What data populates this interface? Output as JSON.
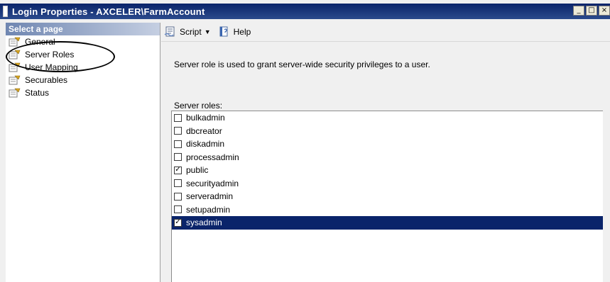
{
  "window": {
    "title": "Login Properties - AXCELER\\FarmAccount",
    "caption_buttons": {
      "minimize": "_",
      "maximize": "□",
      "close": "×"
    }
  },
  "left_pane": {
    "header": "Select a page",
    "items": [
      {
        "label": "General",
        "icon": "page-wrench-icon"
      },
      {
        "label": "Server Roles",
        "icon": "page-wrench-icon",
        "circled": true
      },
      {
        "label": "User Mapping",
        "icon": "page-wrench-icon"
      },
      {
        "label": "Securables",
        "icon": "page-wrench-icon"
      },
      {
        "label": "Status",
        "icon": "page-wrench-icon"
      }
    ]
  },
  "toolbar": {
    "script_label": "Script",
    "script_icon": "script-icon",
    "help_label": "Help",
    "help_icon": "help-icon"
  },
  "main": {
    "description": "Server role is used to grant server-wide security privileges to a user.",
    "roles_label": "Server roles:",
    "roles": [
      {
        "name": "bulkadmin",
        "checked": false
      },
      {
        "name": "dbcreator",
        "checked": false
      },
      {
        "name": "diskadmin",
        "checked": false
      },
      {
        "name": "processadmin",
        "checked": false
      },
      {
        "name": "public",
        "checked": true
      },
      {
        "name": "securityadmin",
        "checked": false
      },
      {
        "name": "serveradmin",
        "checked": false
      },
      {
        "name": "setupadmin",
        "checked": false
      },
      {
        "name": "sysadmin",
        "checked": true,
        "selected": true
      }
    ]
  },
  "colors": {
    "titlebar": "#0a246a",
    "selection": "#0a246a",
    "header_gradient_start": "#6f86b1"
  }
}
